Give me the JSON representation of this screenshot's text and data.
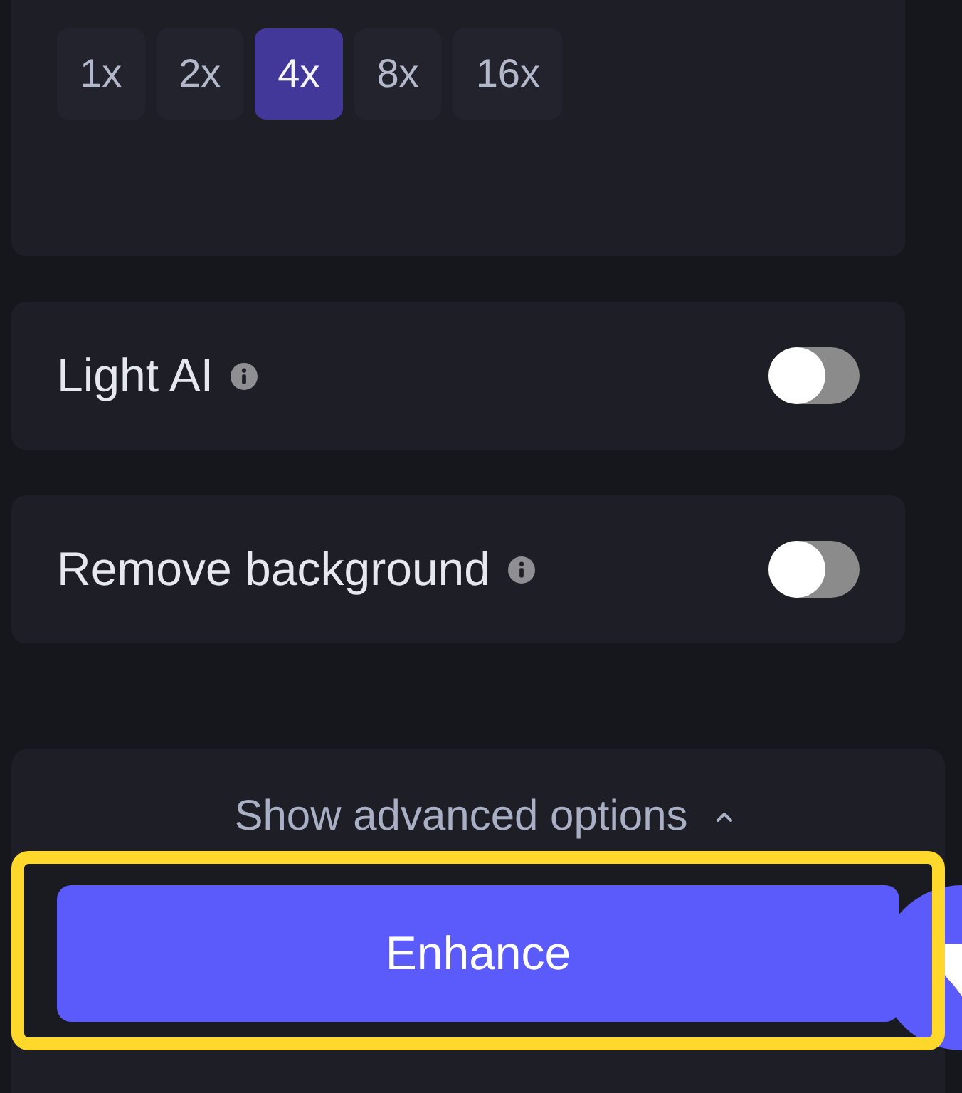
{
  "scale_options": [
    {
      "label": "1x",
      "selected": false
    },
    {
      "label": "2x",
      "selected": false
    },
    {
      "label": "4x",
      "selected": true
    },
    {
      "label": "8x",
      "selected": false
    },
    {
      "label": "16x",
      "selected": false
    }
  ],
  "toggles": [
    {
      "label": "Light AI",
      "on": false
    },
    {
      "label": "Remove background",
      "on": false
    }
  ],
  "advanced_options": {
    "label": "Show advanced options"
  },
  "primary_button": {
    "label": "Enhance"
  }
}
